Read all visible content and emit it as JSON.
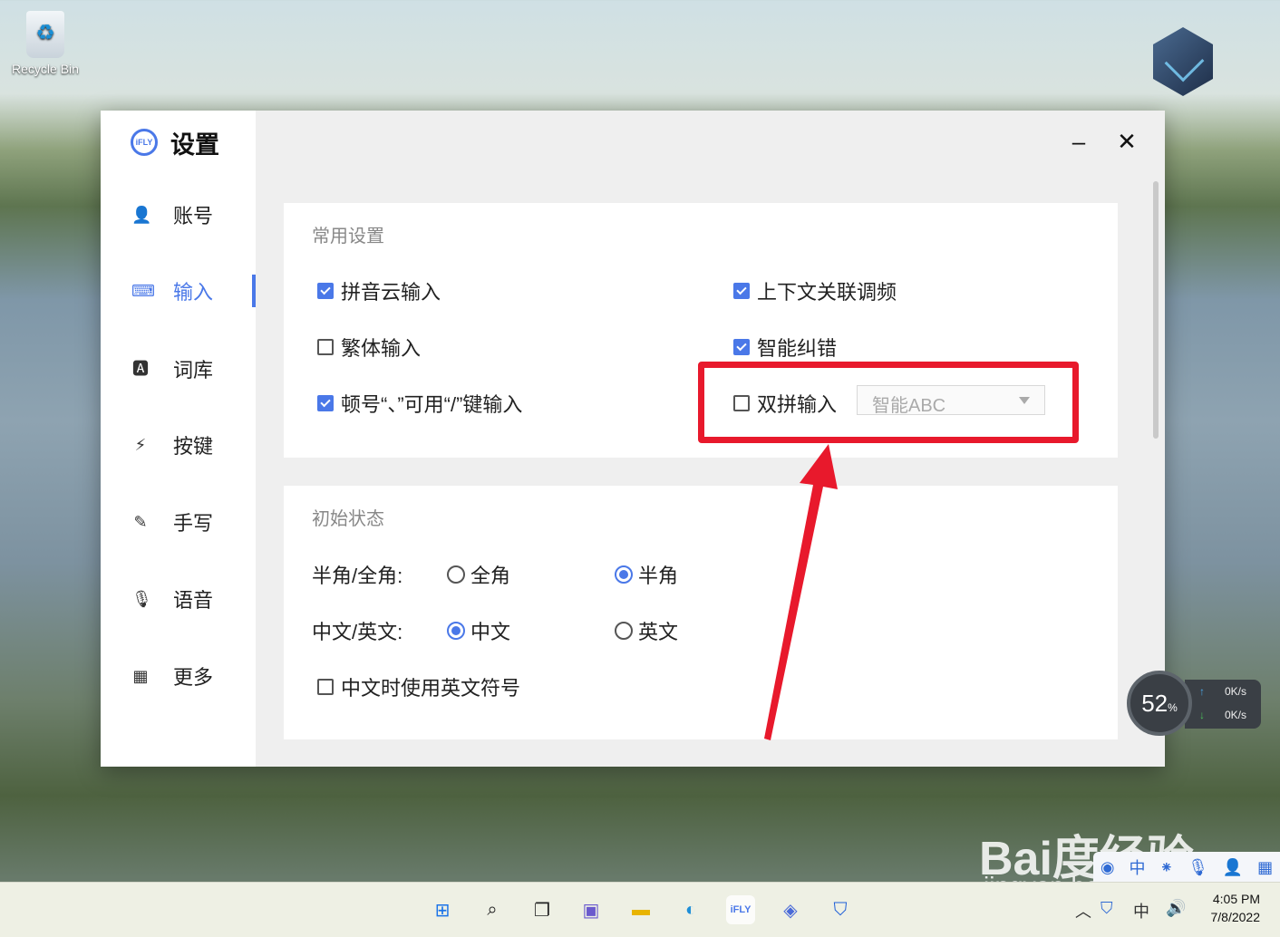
{
  "desktop": {
    "recycle_bin_label": "Recycle Bin"
  },
  "window": {
    "title": "设置",
    "logo_text": "iFLY",
    "minimize_symbol": "‒",
    "close_symbol": "✕"
  },
  "sidebar": {
    "items": [
      {
        "label": "账号",
        "icon": "person-icon",
        "active": false
      },
      {
        "label": "输入",
        "icon": "keyboard-icon",
        "active": true
      },
      {
        "label": "词库",
        "icon": "dictionary-icon",
        "active": false
      },
      {
        "label": "按键",
        "icon": "lightning-key-icon",
        "active": false
      },
      {
        "label": "手写",
        "icon": "pen-icon",
        "active": false
      },
      {
        "label": "语音",
        "icon": "microphone-icon",
        "active": false
      },
      {
        "label": "更多",
        "icon": "grid-icon",
        "active": false
      }
    ]
  },
  "common_settings": {
    "title": "常用设置",
    "options": [
      {
        "label": "拼音云输入",
        "checked": true
      },
      {
        "label": "上下文关联调频",
        "checked": true
      },
      {
        "label": "繁体输入",
        "checked": false
      },
      {
        "label": "智能纠错",
        "checked": true
      },
      {
        "label": "顿号“、”可用“/”键输入",
        "checked": true
      },
      {
        "label": "双拼输入",
        "checked": false
      }
    ],
    "shuangpin_scheme": {
      "value": "智能ABC"
    }
  },
  "initial_state": {
    "title": "初始状态",
    "width_label": "半角/全角:",
    "width_options": [
      {
        "label": "全角",
        "selected": false
      },
      {
        "label": "半角",
        "selected": true
      }
    ],
    "lang_label": "中文/英文:",
    "lang_options": [
      {
        "label": "中文",
        "selected": true
      },
      {
        "label": "英文",
        "selected": false
      }
    ],
    "english_punct": {
      "label": "中文时使用英文符号",
      "checked": false
    }
  },
  "annotation": {
    "color": "#e8192c"
  },
  "speed_widget": {
    "percent": "52",
    "unit": "%",
    "up": "0K/s",
    "down": "0K/s"
  },
  "watermark": {
    "brand": "Bai度经验",
    "url": "jingyan.baidu.com"
  },
  "taskbar": {
    "apps": [
      "windows-start-icon",
      "search-icon",
      "task-view-icon",
      "teams-chat-icon",
      "file-explorer-icon",
      "edge-browser-icon",
      "ifly-ime-icon",
      "game-app-icon",
      "security-app-icon"
    ],
    "time": "4:05 PM",
    "date": "7/8/2022"
  },
  "colors": {
    "accent": "#4a78e8",
    "window_bg": "#efefef"
  }
}
